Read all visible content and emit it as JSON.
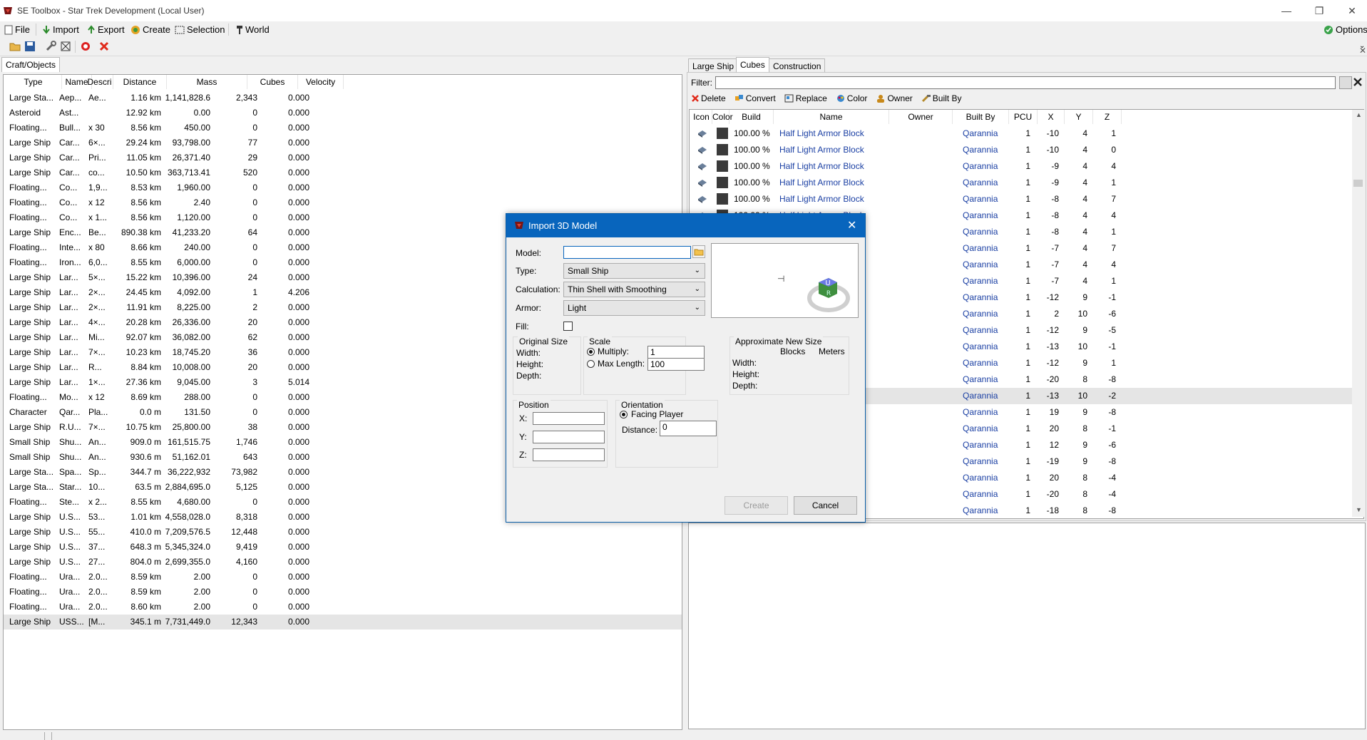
{
  "window": {
    "title": "SE Toolbox - Star Trek Development (Local User)"
  },
  "menu": {
    "file": "File",
    "import": "Import",
    "export": "Export",
    "create": "Create",
    "selection": "Selection",
    "world": "World",
    "options": "Options"
  },
  "left": {
    "tab": "Craft/Objects",
    "columns": [
      "Type",
      "Name",
      "Descri",
      "Distance",
      "Mass",
      "Cubes",
      "Velocity"
    ],
    "rows": [
      [
        "Large Sta...",
        "Aep...",
        "Ae...",
        "1.16 km",
        "1,141,828.6",
        "2,343",
        "0.000"
      ],
      [
        "Asteroid",
        "Ast...",
        "",
        "12.92 km",
        "0.00",
        "0",
        "0.000"
      ],
      [
        "Floating...",
        "Bull...",
        "x 30",
        "8.56 km",
        "450.00",
        "0",
        "0.000"
      ],
      [
        "Large Ship",
        "Car...",
        "6×...",
        "29.24 km",
        "93,798.00",
        "77",
        "0.000"
      ],
      [
        "Large Ship",
        "Car...",
        "Pri...",
        "11.05 km",
        "26,371.40",
        "29",
        "0.000"
      ],
      [
        "Large Ship",
        "Car...",
        "co...",
        "10.50 km",
        "363,713.41",
        "520",
        "0.000"
      ],
      [
        "Floating...",
        "Co...",
        "1,9...",
        "8.53 km",
        "1,960.00",
        "0",
        "0.000"
      ],
      [
        "Floating...",
        "Co...",
        "x 12",
        "8.56 km",
        "2.40",
        "0",
        "0.000"
      ],
      [
        "Floating...",
        "Co...",
        "x 1...",
        "8.56 km",
        "1,120.00",
        "0",
        "0.000"
      ],
      [
        "Large Ship",
        "Enc...",
        "Be...",
        "890.38 km",
        "41,233.20",
        "64",
        "0.000"
      ],
      [
        "Floating...",
        "Inte...",
        "x 80",
        "8.66 km",
        "240.00",
        "0",
        "0.000"
      ],
      [
        "Floating...",
        "Iron...",
        "6,0...",
        "8.55 km",
        "6,000.00",
        "0",
        "0.000"
      ],
      [
        "Large Ship",
        "Lar...",
        "5×...",
        "15.22 km",
        "10,396.00",
        "24",
        "0.000"
      ],
      [
        "Large Ship",
        "Lar...",
        "2×...",
        "24.45 km",
        "4,092.00",
        "1",
        "4.206"
      ],
      [
        "Large Ship",
        "Lar...",
        "2×...",
        "11.91 km",
        "8,225.00",
        "2",
        "0.000"
      ],
      [
        "Large Ship",
        "Lar...",
        "4×...",
        "20.28 km",
        "26,336.00",
        "20",
        "0.000"
      ],
      [
        "Large Ship",
        "Lar...",
        "Mi...",
        "92.07 km",
        "36,082.00",
        "62",
        "0.000"
      ],
      [
        "Large Ship",
        "Lar...",
        "7×...",
        "10.23 km",
        "18,745.20",
        "36",
        "0.000"
      ],
      [
        "Large Ship",
        "Lar...",
        "R...",
        "8.84 km",
        "10,008.00",
        "20",
        "0.000"
      ],
      [
        "Large Ship",
        "Lar...",
        "1×...",
        "27.36 km",
        "9,045.00",
        "3",
        "5.014"
      ],
      [
        "Floating...",
        "Mo...",
        "x 12",
        "8.69 km",
        "288.00",
        "0",
        "0.000"
      ],
      [
        "Character",
        "Qar...",
        "Pla...",
        "0.0 m",
        "131.50",
        "0",
        "0.000"
      ],
      [
        "Large Ship",
        "R.U...",
        "7×...",
        "10.75 km",
        "25,800.00",
        "38",
        "0.000"
      ],
      [
        "Small Ship",
        "Shu...",
        "An...",
        "909.0 m",
        "161,515.75",
        "1,746",
        "0.000"
      ],
      [
        "Small Ship",
        "Shu...",
        "An...",
        "930.6 m",
        "51,162.01",
        "643",
        "0.000"
      ],
      [
        "Large Sta...",
        "Spa...",
        "Sp...",
        "344.7 m",
        "36,222,932",
        "73,982",
        "0.000"
      ],
      [
        "Large Sta...",
        "Star...",
        "10...",
        "63.5 m",
        "2,884,695.0",
        "5,125",
        "0.000"
      ],
      [
        "Floating...",
        "Ste...",
        "x 2...",
        "8.55 km",
        "4,680.00",
        "0",
        "0.000"
      ],
      [
        "Large Ship",
        "U.S...",
        "53...",
        "1.01 km",
        "4,558,028.0",
        "8,318",
        "0.000"
      ],
      [
        "Large Ship",
        "U.S...",
        "55...",
        "410.0 m",
        "7,209,576.5",
        "12,448",
        "0.000"
      ],
      [
        "Large Ship",
        "U.S...",
        "37...",
        "648.3 m",
        "5,345,324.0",
        "9,419",
        "0.000"
      ],
      [
        "Large Ship",
        "U.S...",
        "27...",
        "804.0 m",
        "2,699,355.0",
        "4,160",
        "0.000"
      ],
      [
        "Floating...",
        "Ura...",
        "2.0...",
        "8.59 km",
        "2.00",
        "0",
        "0.000"
      ],
      [
        "Floating...",
        "Ura...",
        "2.0...",
        "8.59 km",
        "2.00",
        "0",
        "0.000"
      ],
      [
        "Floating...",
        "Ura...",
        "2.0...",
        "8.60 km",
        "2.00",
        "0",
        "0.000"
      ],
      [
        "Large Ship",
        "USS...",
        "[M...",
        "345.1 m",
        "7,731,449.0",
        "12,343",
        "0.000"
      ]
    ]
  },
  "right": {
    "tabs": [
      "Large Ship",
      "Cubes",
      "Construction"
    ],
    "filter_label": "Filter:",
    "actions": [
      "Delete",
      "Convert",
      "Replace",
      "Color",
      "Owner",
      "Built By"
    ],
    "columns": [
      "Icon",
      "Color",
      "Build",
      "Name",
      "Owner",
      "Built By",
      "PCU",
      "X",
      "Y",
      "Z"
    ],
    "rows": [
      [
        "100.00 %",
        "Half Light Armor Block",
        "",
        "Qarannia",
        "1",
        "-10",
        "4",
        "1"
      ],
      [
        "100.00 %",
        "Half Light Armor Block",
        "",
        "Qarannia",
        "1",
        "-10",
        "4",
        "0"
      ],
      [
        "100.00 %",
        "Half Light Armor Block",
        "",
        "Qarannia",
        "1",
        "-9",
        "4",
        "4"
      ],
      [
        "100.00 %",
        "Half Light Armor Block",
        "",
        "Qarannia",
        "1",
        "-9",
        "4",
        "1"
      ],
      [
        "100.00 %",
        "Half Light Armor Block",
        "",
        "Qarannia",
        "1",
        "-8",
        "4",
        "7"
      ],
      [
        "100.00 %",
        "Half Light Armor Block",
        "",
        "Qarannia",
        "1",
        "-8",
        "4",
        "4"
      ],
      [
        "",
        "",
        "",
        "Qarannia",
        "1",
        "-8",
        "4",
        "1"
      ],
      [
        "",
        "",
        "",
        "Qarannia",
        "1",
        "-7",
        "4",
        "7"
      ],
      [
        "",
        "",
        "",
        "Qarannia",
        "1",
        "-7",
        "4",
        "4"
      ],
      [
        "",
        "",
        "",
        "Qarannia",
        "1",
        "-7",
        "4",
        "1"
      ],
      [
        "",
        "",
        "",
        "Qarannia",
        "1",
        "-12",
        "9",
        "-1"
      ],
      [
        "",
        "",
        "",
        "Qarannia",
        "1",
        "2",
        "10",
        "-6"
      ],
      [
        "",
        "",
        "",
        "Qarannia",
        "1",
        "-12",
        "9",
        "-5"
      ],
      [
        "",
        "",
        "",
        "Qarannia",
        "1",
        "-13",
        "10",
        "-1"
      ],
      [
        "",
        "",
        "",
        "Qarannia",
        "1",
        "-12",
        "9",
        "1"
      ],
      [
        "",
        "",
        "",
        "Qarannia",
        "1",
        "-20",
        "8",
        "-8"
      ],
      [
        "",
        "",
        "",
        "Qarannia",
        "1",
        "-13",
        "10",
        "-2"
      ],
      [
        "",
        "",
        "",
        "Qarannia",
        "1",
        "19",
        "9",
        "-8"
      ],
      [
        "",
        "",
        "",
        "Qarannia",
        "1",
        "20",
        "8",
        "-1"
      ],
      [
        "",
        "",
        "",
        "Qarannia",
        "1",
        "12",
        "9",
        "-6"
      ],
      [
        "",
        "",
        "",
        "Qarannia",
        "1",
        "-19",
        "9",
        "-8"
      ],
      [
        "",
        "",
        "",
        "Qarannia",
        "1",
        "20",
        "8",
        "-4"
      ],
      [
        "",
        "",
        "",
        "Qarannia",
        "1",
        "-20",
        "8",
        "-4"
      ],
      [
        "",
        "",
        "",
        "Qarannia",
        "1",
        "-18",
        "8",
        "-8"
      ]
    ]
  },
  "dialog": {
    "title": "Import 3D Model",
    "model_label": "Model:",
    "model_value": "",
    "type_label": "Type:",
    "type_value": "Small Ship",
    "calculation_label": "Calculation:",
    "calculation_value": "Thin Shell with Smoothing",
    "armor_label": "Armor:",
    "armor_value": "Light",
    "fill_label": "Fill:",
    "original_size": {
      "title": "Original Size",
      "width": "Width:",
      "height": "Height:",
      "depth": "Depth:"
    },
    "scale": {
      "title": "Scale",
      "multiply": "Multiply:",
      "multiply_value": "1",
      "max_length": "Max Length:",
      "max_length_value": "100"
    },
    "new_size": {
      "title": "Approximate New Size",
      "blocks": "Blocks",
      "meters": "Meters",
      "width": "Width:",
      "height": "Height:",
      "depth": "Depth:"
    },
    "position": {
      "title": "Position",
      "x": "X:",
      "y": "Y:",
      "z": "Z:"
    },
    "orientation": {
      "title": "Orientation",
      "facing": "Facing Player",
      "distance": "Distance:",
      "distance_value": "0"
    },
    "create": "Create",
    "cancel": "Cancel"
  },
  "colors": {
    "accent": "#0865bd",
    "link": "#1a3fa3",
    "block_color": "#3a3a3a"
  }
}
